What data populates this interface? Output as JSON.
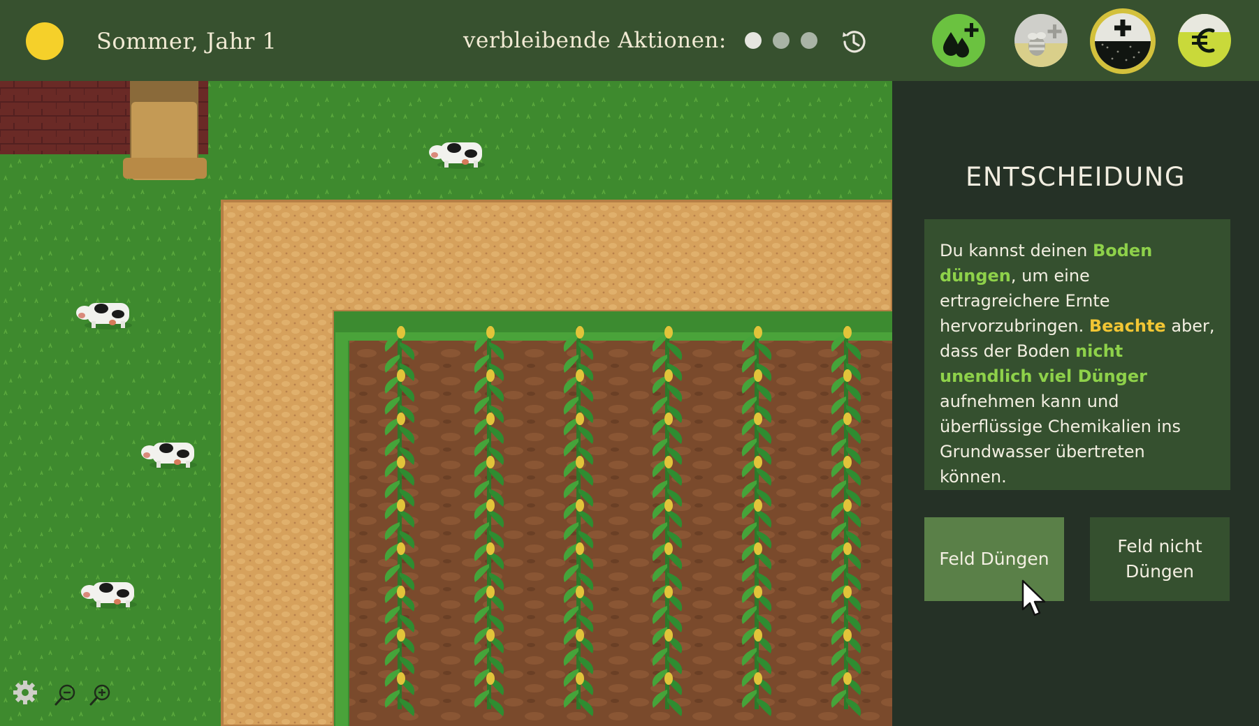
{
  "header": {
    "season": "Sommer, Jahr 1",
    "actions_label": "verbleibende Aktionen:",
    "actions_remaining": 3
  },
  "resources": [
    {
      "name": "water",
      "icon": "water-drops-plus-icon"
    },
    {
      "name": "bees",
      "icon": "bee-plus-icon"
    },
    {
      "name": "soil",
      "icon": "soil-plus-icon",
      "selected": true
    },
    {
      "name": "money",
      "icon": "euro-icon"
    }
  ],
  "panel": {
    "title": "ENTSCHEIDUNG",
    "info": {
      "t1": "Du kannst deinen ",
      "h1": "Boden düngen",
      "t2": ", um eine ertragreichere Ernte hervorzubringen. ",
      "h2": "Beachte",
      "t3": " aber, dass der Boden ",
      "h3": "nicht unendlich viel Dünger",
      "t4": " aufnehmen kann und überflüssige Chemikalien ins Grundwasser übertreten können."
    },
    "buttons": {
      "fertilize": "Feld Düngen",
      "no_fertilize": "Feld nicht Düngen"
    }
  },
  "colors": {
    "topbar": "#37512f",
    "panel": "#253126",
    "accent_green": "#8ed14a",
    "accent_yellow": "#f2c634",
    "sun": "#f5d02a"
  }
}
